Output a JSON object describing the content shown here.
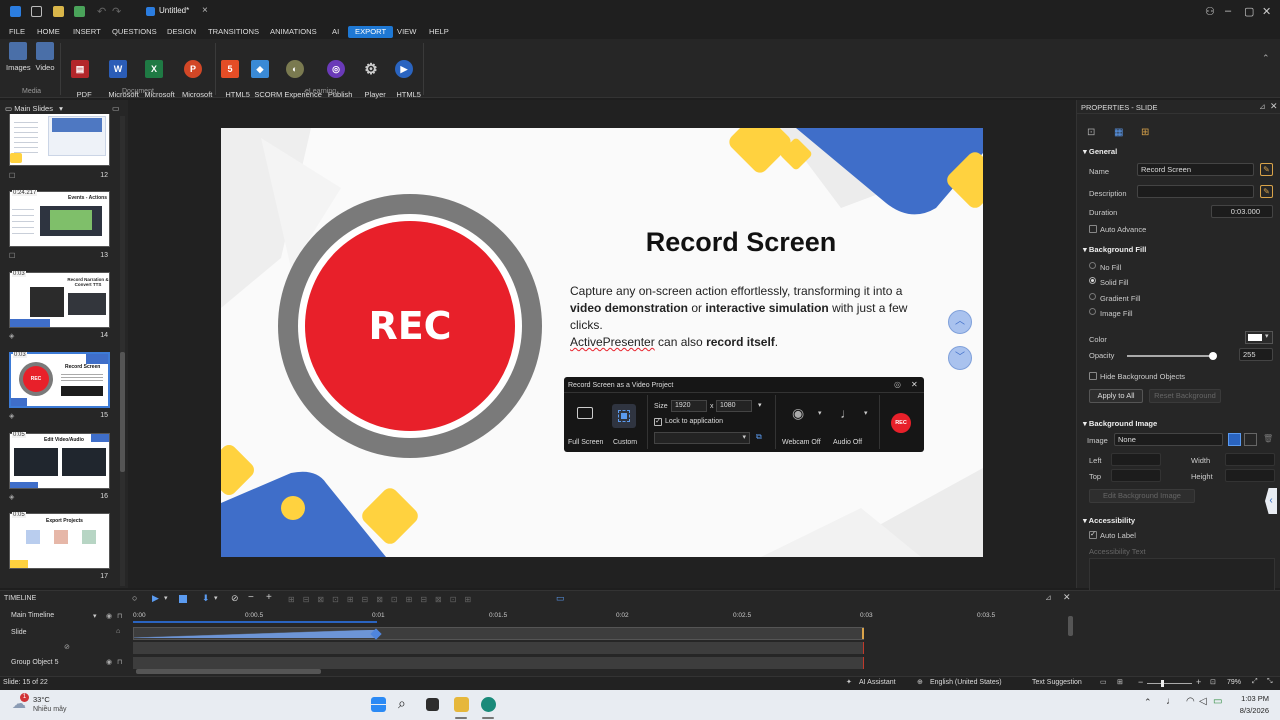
{
  "titlebar": {
    "title": "Untitled*"
  },
  "menu": [
    "FILE",
    "HOME",
    "INSERT",
    "QUESTIONS",
    "DESIGN",
    "TRANSITIONS",
    "ANIMATIONS",
    "AI",
    "EXPORT",
    "VIEW",
    "HELP"
  ],
  "menu_active": "EXPORT",
  "ribbon": {
    "buttons": [
      {
        "label": "Images",
        "icon": "images-icon"
      },
      {
        "label": "Video",
        "icon": "video-icon"
      },
      {
        "label": "PDF\nDocument",
        "icon": "pdf-icon"
      },
      {
        "label": "Microsoft\nWord",
        "icon": "word-icon"
      },
      {
        "label": "Microsoft\nExcel",
        "icon": "excel-icon"
      },
      {
        "label": "Microsoft\nPowerPoint",
        "icon": "powerpoint-icon"
      },
      {
        "label": "HTML5",
        "icon": "html5-icon"
      },
      {
        "label": "SCORM",
        "icon": "scorm-icon"
      },
      {
        "label": "Experience\nAPI",
        "icon": "xapi-icon"
      },
      {
        "label": "Publish\nuPresenter",
        "icon": "upresenter-icon"
      },
      {
        "label": "Player\nSettings",
        "icon": "gear-icon"
      },
      {
        "label": "HTML5\nPreview ▾",
        "icon": "play-icon"
      }
    ],
    "groups": [
      "Media",
      "Document",
      "eLearning"
    ]
  },
  "left_panel": {
    "header": "Main Slides",
    "thumbs": [
      {
        "num": "12",
        "time": ""
      },
      {
        "num": "13",
        "time": "0:24.217",
        "title": "Events - Actions"
      },
      {
        "num": "14",
        "time": "0:03",
        "title": "Record Narration & Convert TTS"
      },
      {
        "num": "15",
        "time": "0:03",
        "title": "Record Screen"
      },
      {
        "num": "16",
        "time": "0:05",
        "title": "Edit Video/Audio"
      },
      {
        "num": "17",
        "time": "0:05",
        "title": "Export Projects"
      }
    ]
  },
  "slide": {
    "title": "Record Screen",
    "rec_label": "REC",
    "body_part1": "Capture any on-screen action effortlessly, transforming it into a ",
    "bold1": "video demonstration",
    "body_part2": " or ",
    "bold2": "interactive simulation",
    "body_part3": " with just a few clicks.",
    "line2_part1": "ActivePresenter",
    "line2_part2": " can also ",
    "bold3": "record itself",
    "line2_part3": ".",
    "recorder": {
      "title": "Record Screen as a Video Project",
      "full_screen": "Full Screen",
      "custom": "Custom",
      "size_label": "Size",
      "width": "1920",
      "x_label": "x",
      "height": "1080",
      "lock_label": "Lock to application",
      "webcam": "Webcam Off",
      "audio": "Audio Off",
      "rec_btn": "REC"
    }
  },
  "properties": {
    "header": "PROPERTIES - SLIDE",
    "general": "General",
    "name_label": "Name",
    "name_value": "Record Screen",
    "desc_label": "Description",
    "duration_label": "Duration",
    "duration_value": "0:03.000",
    "auto_advance": "Auto Advance",
    "bg_fill": "Background Fill",
    "no_fill": "No Fill",
    "solid_fill": "Solid Fill",
    "gradient_fill": "Gradient Fill",
    "image_fill": "Image Fill",
    "color_label": "Color",
    "opacity_label": "Opacity",
    "opacity_value": "255",
    "opacity_fraction": 1.0,
    "hide_bg": "Hide Background Objects",
    "apply_all": "Apply to All",
    "reset_bg": "Reset Background",
    "bg_image": "Background Image",
    "image_label": "Image",
    "image_value": "None",
    "left_label": "Left",
    "width_label": "Width",
    "top_label": "Top",
    "height_label": "Height",
    "edit_bg_image": "Edit Background Image",
    "accessibility": "Accessibility",
    "auto_label": "Auto Label",
    "accessibility_text": "Accessibility Text"
  },
  "timeline": {
    "header": "TIMELINE",
    "ticks": [
      "0:00",
      "0:00.5",
      "0:01",
      "0:01.5",
      "0:02",
      "0:02.5",
      "0:03",
      "0:03.5"
    ],
    "rows": [
      "Main Timeline",
      "Slide",
      "",
      "Group Object 5"
    ]
  },
  "status": {
    "slide_info": "Slide: 15 of 22",
    "ai": "AI Assistant",
    "lang": "English (United States)",
    "text_suggestion": "Text Suggestion",
    "zoom": "79%"
  },
  "taskbar": {
    "temp": "33°C",
    "weather": "Nhiều mây",
    "notif": "1",
    "time": "1:03 PM",
    "date": "8/3/2026"
  },
  "colors": {
    "accent": "#1e78d4",
    "rec_red": "#e8202a",
    "yellow": "#ffd23f",
    "blue": "#3f6ec9"
  }
}
